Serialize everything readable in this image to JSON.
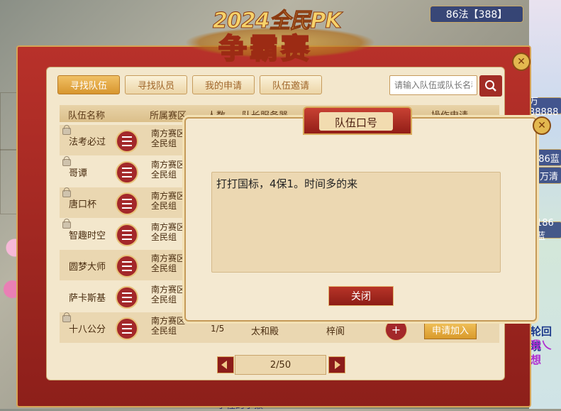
{
  "scene": {
    "top_names": [
      "86法【388】",
      "万38888",
      "86蓝",
      "万清",
      "186蓝"
    ],
    "side_texts": [
      "轮回境",
      "我乀想"
    ],
    "bottom_text": "小怪的小猴"
  },
  "banner": {
    "year_text": "2024全民PK",
    "main_text": "争霸赛"
  },
  "tabs": [
    {
      "label": "寻找队伍",
      "active": true
    },
    {
      "label": "寻找队员",
      "active": false
    },
    {
      "label": "我的申请",
      "active": false
    },
    {
      "label": "队伍邀请",
      "active": false
    }
  ],
  "search": {
    "placeholder": "请输入队伍或队长名称"
  },
  "table": {
    "headers": {
      "team_name": "队伍名称",
      "zone": "所属赛区",
      "count": "人数",
      "leader_server": "队长服务器",
      "action": "操作申请"
    },
    "rows": [
      {
        "name": "法考必过",
        "zone": "南方赛区\n全民组"
      },
      {
        "name": "哥谭",
        "zone": "南方赛区\n全民组"
      },
      {
        "name": "唐口杯",
        "zone": "南方赛区\n全民组"
      },
      {
        "name": "智趣时空",
        "zone": "南方赛区\n全民组"
      },
      {
        "name": "圆梦大师",
        "zone": "南方赛区\n全民组"
      },
      {
        "name": "萨卡斯基",
        "zone": "南方赛区\n全民组"
      },
      {
        "name": "十八公分",
        "zone": "南方赛区\n全民组",
        "count": "1/5",
        "server": "太和殿",
        "leader": "梓阆"
      }
    ],
    "apply_label": "申请加入"
  },
  "pager": {
    "text": "2/50"
  },
  "modal": {
    "title": "队伍口号",
    "slogan": "打打国标，4保1。时间多的来",
    "close_label": "关闭"
  },
  "colors": {
    "panel_red": "#a3282a",
    "gold": "#d9a55a",
    "parchment": "#f3e7cc"
  }
}
